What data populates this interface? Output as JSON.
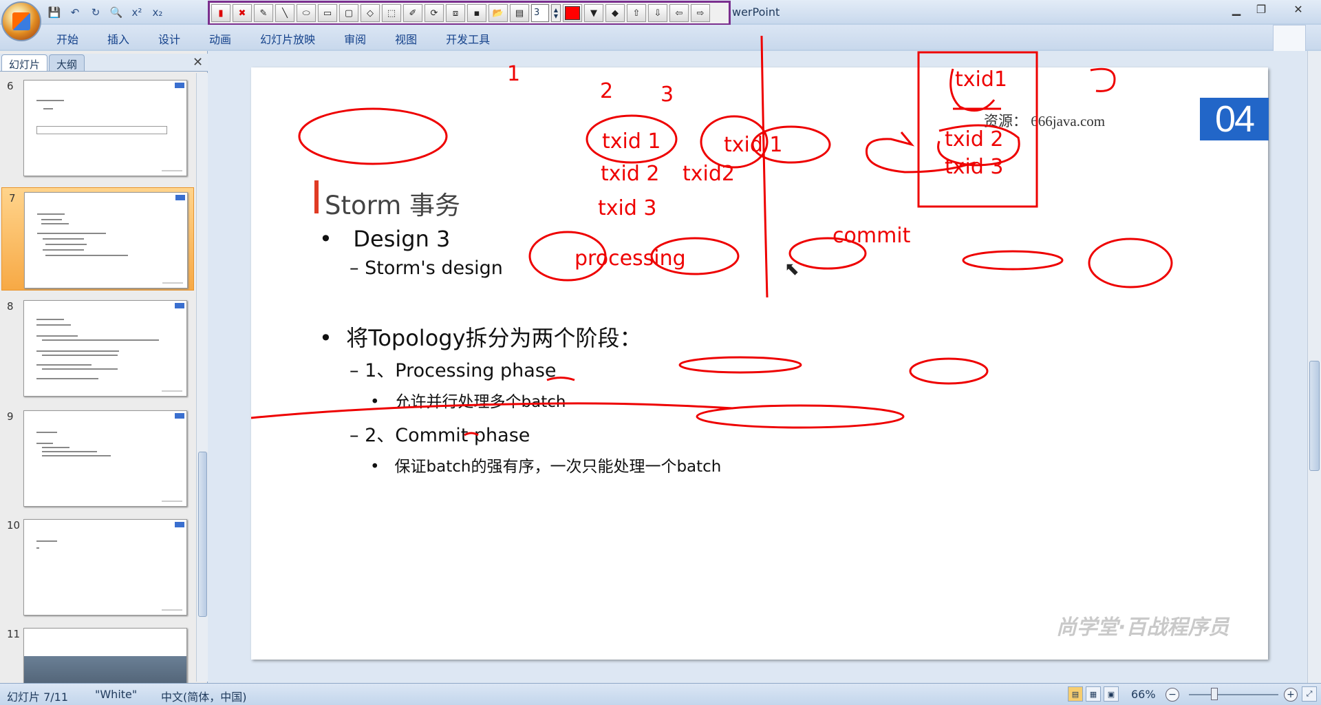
{
  "window": {
    "title": "werPoint"
  },
  "qat": {
    "icons": [
      "save-icon",
      "undo-icon",
      "redo-icon",
      "print-preview-icon",
      "superscript-icon",
      "subscript-icon"
    ],
    "superscript": "x²",
    "subscript": "x₂"
  },
  "pen_toolbar": {
    "pen_width": "3",
    "color": "#ff0000"
  },
  "ribbon": {
    "tabs": [
      "开始",
      "插入",
      "设计",
      "动画",
      "幻灯片放映",
      "审阅",
      "视图",
      "开发工具"
    ]
  },
  "side_pane": {
    "tabs": [
      "幻灯片",
      "大纲"
    ],
    "close": "✕",
    "slides": [
      {
        "num": "6"
      },
      {
        "num": "7",
        "selected": true
      },
      {
        "num": "8"
      },
      {
        "num": "9"
      },
      {
        "num": "10"
      },
      {
        "num": "11"
      }
    ]
  },
  "slide": {
    "badge": "04",
    "watermark_url": "资源： 666java.com",
    "logo_watermark": "尚学堂·百战程序员",
    "title": "Storm 事务",
    "bullet1": "Design 3",
    "bullet1_sub": "Storm's design",
    "bullet2": "将Topology拆分为两个阶段：",
    "bullet2_sub1": "1、Processing phase",
    "bullet2_sub1_detail": "允许并行处理多个batch",
    "bullet2_sub2": "2、Commit phase",
    "bullet2_sub2_detail": "保证batch的强有序，一次只能处理一个batch",
    "bullet_mark": "•",
    "dash_mark": "–"
  },
  "ink_annotations": {
    "labels": [
      "1",
      "2",
      "3",
      "txid 1",
      "txid 1",
      "txid 2",
      "txid2",
      "txid 3",
      "processing",
      "commit",
      "txid1",
      "txid 2",
      "txid 3"
    ]
  },
  "status": {
    "slide_info": "幻灯片 7/11",
    "theme": "\"White\"",
    "language": "中文(简体，中国)",
    "zoom": "66%"
  }
}
